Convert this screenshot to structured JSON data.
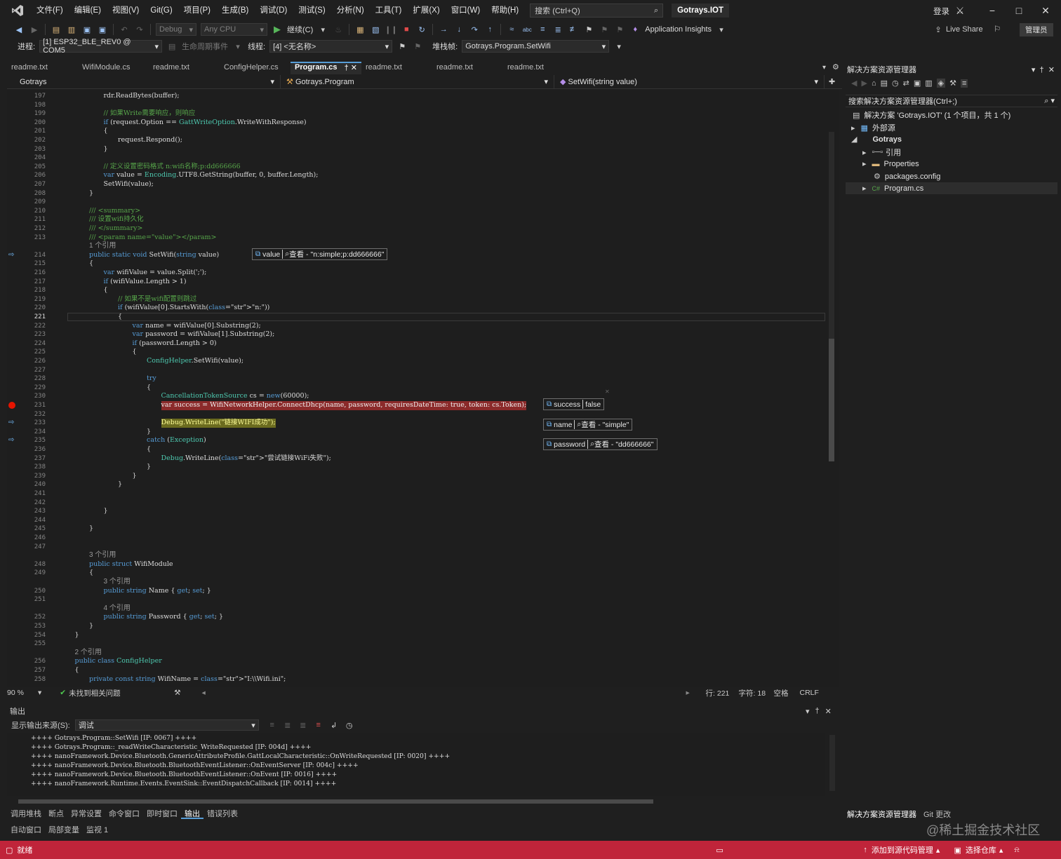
{
  "titlebar": {
    "menus": [
      "文件(F)",
      "编辑(E)",
      "视图(V)",
      "Git(G)",
      "项目(P)",
      "生成(B)",
      "调试(D)",
      "测试(S)",
      "分析(N)",
      "工具(T)",
      "扩展(X)",
      "窗口(W)",
      "帮助(H)"
    ],
    "search_placeholder": "搜索 (Ctrl+Q)",
    "app_title": "Gotrays.IOT",
    "login": "登录"
  },
  "toolbar1": {
    "config": "Debug",
    "platform": "Any CPU",
    "continue": "继续(C)",
    "app_insights": "Application Insights",
    "live_share": "Live Share",
    "admin": "管理员"
  },
  "toolbar2": {
    "process_label": "进程:",
    "process_value": "[1] ESP32_BLE_REV0 @ COM5",
    "lifecycle": "生命周期事件",
    "thread_label": "线程:",
    "thread_value": "[4] <无名称>",
    "stackframe_label": "堆栈帧:",
    "stackframe_value": "Gotrays.Program.SetWifi"
  },
  "tabs": [
    "readme.txt",
    "WifiModule.cs",
    "readme.txt",
    "ConfigHelper.cs",
    "Program.cs",
    "readme.txt",
    "readme.txt",
    "readme.txt"
  ],
  "navbar": {
    "project": "Gotrays",
    "type": "Gotrays.Program",
    "member": "SetWifi(string value)"
  },
  "code_lines": [
    {
      "n": "197",
      "t": "rdr.ReadBytes(buffer);",
      "ind": 3,
      "c": "nm"
    },
    {
      "n": "198",
      "t": "",
      "ind": 0,
      "c": "nm"
    },
    {
      "n": "199",
      "t": "// 如果Write需要响应，则响应",
      "ind": 3,
      "c": "cmt"
    },
    {
      "n": "200",
      "t": "if (request.Option == GattWriteOption.WriteWithResponse)",
      "ind": 3,
      "c": "nm"
    },
    {
      "n": "201",
      "t": "{",
      "ind": 3,
      "c": "nm"
    },
    {
      "n": "202",
      "t": "request.Respond();",
      "ind": 4,
      "c": "nm"
    },
    {
      "n": "203",
      "t": "}",
      "ind": 3,
      "c": "nm"
    },
    {
      "n": "204",
      "t": "",
      "ind": 0,
      "c": "nm"
    },
    {
      "n": "205",
      "t": "// 定义设置密码格式 n:wifi名称;p:dd666666",
      "ind": 3,
      "c": "cmt"
    },
    {
      "n": "206",
      "t": "var value = Encoding.UTF8.GetString(buffer, 0, buffer.Length);",
      "ind": 3,
      "c": "nm"
    },
    {
      "n": "207",
      "t": "SetWifi(value);",
      "ind": 3,
      "c": "nm"
    },
    {
      "n": "208",
      "t": "}",
      "ind": 2,
      "c": "nm"
    },
    {
      "n": "209",
      "t": "",
      "ind": 0,
      "c": "nm"
    },
    {
      "n": "210",
      "t": "/// <summary>",
      "ind": 2,
      "c": "cmt"
    },
    {
      "n": "211",
      "t": "/// 设置wifi持久化",
      "ind": 2,
      "c": "cmt"
    },
    {
      "n": "212",
      "t": "/// </summary>",
      "ind": 2,
      "c": "cmt"
    },
    {
      "n": "213",
      "t": "/// <param name=\"value\"></param>",
      "ind": 2,
      "c": "cmt"
    },
    {
      "n": "",
      "t": "1 个引用",
      "ind": 2,
      "c": "lens"
    },
    {
      "n": "214",
      "t": "public static void SetWifi(string value)",
      "ind": 2,
      "c": "kw"
    },
    {
      "n": "215",
      "t": "{",
      "ind": 2,
      "c": "nm"
    },
    {
      "n": "216",
      "t": "var wifiValue = value.Split(';');",
      "ind": 3,
      "c": "nm"
    },
    {
      "n": "217",
      "t": "if (wifiValue.Length > 1)",
      "ind": 3,
      "c": "nm"
    },
    {
      "n": "218",
      "t": "{",
      "ind": 3,
      "c": "nm"
    },
    {
      "n": "219",
      "t": "// 如果不是wifi配置则跳过",
      "ind": 4,
      "c": "cmt"
    },
    {
      "n": "220",
      "t": "if (wifiValue[0].StartsWith(\"n:\"))",
      "ind": 4,
      "c": "nm"
    },
    {
      "n": "221",
      "t": "{",
      "ind": 4,
      "c": "nm"
    },
    {
      "n": "222",
      "t": "var name = wifiValue[0].Substring(2);",
      "ind": 5,
      "c": "nm"
    },
    {
      "n": "223",
      "t": "var password = wifiValue[1].Substring(2);",
      "ind": 5,
      "c": "nm"
    },
    {
      "n": "224",
      "t": "if (password.Length > 0)",
      "ind": 5,
      "c": "nm"
    },
    {
      "n": "225",
      "t": "{",
      "ind": 5,
      "c": "nm"
    },
    {
      "n": "226",
      "t": "ConfigHelper.SetWifi(value);",
      "ind": 6,
      "c": "nm"
    },
    {
      "n": "227",
      "t": "",
      "ind": 0,
      "c": "nm"
    },
    {
      "n": "228",
      "t": "try",
      "ind": 6,
      "c": "kw"
    },
    {
      "n": "229",
      "t": "{",
      "ind": 6,
      "c": "nm"
    },
    {
      "n": "230",
      "t": "CancellationTokenSource cs = new(60000);",
      "ind": 7,
      "c": "cls"
    },
    {
      "n": "231",
      "t": "var success = WifiNetworkHelper.ConnectDhcp(name, password, requiresDateTime: true, token: cs.Token);",
      "ind": 7,
      "c": "bp"
    },
    {
      "n": "232",
      "t": "",
      "ind": 0,
      "c": "nm"
    },
    {
      "n": "233",
      "t": "Debug.WriteLine(\"链接WIFI成功\");",
      "ind": 7,
      "c": "cur"
    },
    {
      "n": "234",
      "t": "}",
      "ind": 6,
      "c": "nm"
    },
    {
      "n": "235",
      "t": "catch (Exception)",
      "ind": 6,
      "c": "kw"
    },
    {
      "n": "236",
      "t": "{",
      "ind": 6,
      "c": "nm"
    },
    {
      "n": "237",
      "t": "Debug.WriteLine(\"尝试链接WiFi失败\");",
      "ind": 7,
      "c": "cls"
    },
    {
      "n": "238",
      "t": "}",
      "ind": 6,
      "c": "nm"
    },
    {
      "n": "239",
      "t": "}",
      "ind": 5,
      "c": "nm"
    },
    {
      "n": "240",
      "t": "}",
      "ind": 4,
      "c": "nm"
    },
    {
      "n": "241",
      "t": "",
      "ind": 0,
      "c": "nm"
    },
    {
      "n": "242",
      "t": "",
      "ind": 0,
      "c": "nm"
    },
    {
      "n": "243",
      "t": "}",
      "ind": 3,
      "c": "nm"
    },
    {
      "n": "244",
      "t": "",
      "ind": 0,
      "c": "nm"
    },
    {
      "n": "245",
      "t": "}",
      "ind": 2,
      "c": "nm"
    },
    {
      "n": "246",
      "t": "",
      "ind": 0,
      "c": "nm"
    },
    {
      "n": "247",
      "t": "",
      "ind": 0,
      "c": "nm"
    },
    {
      "n": "",
      "t": "3 个引用",
      "ind": 2,
      "c": "lens"
    },
    {
      "n": "248",
      "t": "public struct WifiModule",
      "ind": 2,
      "c": "kw"
    },
    {
      "n": "249",
      "t": "{",
      "ind": 2,
      "c": "nm"
    },
    {
      "n": "",
      "t": "3 个引用",
      "ind": 3,
      "c": "lens"
    },
    {
      "n": "250",
      "t": "public string Name { get; set; }",
      "ind": 3,
      "c": "kw"
    },
    {
      "n": "251",
      "t": "",
      "ind": 0,
      "c": "nm"
    },
    {
      "n": "",
      "t": "4 个引用",
      "ind": 3,
      "c": "lens"
    },
    {
      "n": "252",
      "t": "public string Password { get; set; }",
      "ind": 3,
      "c": "kw"
    },
    {
      "n": "253",
      "t": "}",
      "ind": 2,
      "c": "nm"
    },
    {
      "n": "254",
      "t": "}",
      "ind": 1,
      "c": "nm"
    },
    {
      "n": "255",
      "t": "",
      "ind": 0,
      "c": "nm"
    },
    {
      "n": "",
      "t": "2 个引用",
      "ind": 1,
      "c": "lens"
    },
    {
      "n": "256",
      "t": "public class ConfigHelper",
      "ind": 1,
      "c": "kw"
    },
    {
      "n": "257",
      "t": "{",
      "ind": 1,
      "c": "nm"
    },
    {
      "n": "258",
      "t": "private const string WifiName = \"I:\\\\Wifi.ini\";",
      "ind": 2,
      "c": "kw"
    }
  ],
  "datatips": {
    "value": {
      "name": "value",
      "text": "查看 - \"n:simple;p:dd666666\""
    },
    "success": {
      "name": "success",
      "text": "false"
    },
    "name": {
      "name": "name",
      "text": "查看 - \"simple\""
    },
    "password": {
      "name": "password",
      "text": "查看 - \"dd666666\""
    }
  },
  "editor_status": {
    "zoom": "90 %",
    "issues": "未找到相关问题",
    "line": "行: 221",
    "col": "字符: 18",
    "spaces": "空格",
    "eol": "CRLF"
  },
  "output": {
    "title": "输出",
    "source_label": "显示输出来源(S):",
    "source_value": "调试",
    "lines": [
      "++++ Gotrays.Program::SetWifi [IP: 0067] ++++",
      "++++ Gotrays.Program::_readWriteCharacteristic_WriteRequested [IP: 004d] ++++",
      "++++ nanoFramework.Device.Bluetooth.GenericAttributeProfile.GattLocalCharacteristic::OnWriteRequested [IP: 0020] ++++",
      "++++ nanoFramework.Device.Bluetooth.BluetoothEventListener::OnEventServer [IP: 004c] ++++",
      "++++ nanoFramework.Device.Bluetooth.BluetoothEventListener::OnEvent [IP: 0016] ++++",
      "++++ nanoFramework.Runtime.Events.EventSink::EventDispatchCallback [IP: 0014] ++++"
    ]
  },
  "bottom_tabs": [
    "调用堆栈",
    "断点",
    "异常设置",
    "命令窗口",
    "即时窗口",
    "输出",
    "错误列表"
  ],
  "bottom_tabs2": [
    "自动窗口",
    "局部变量",
    "监视 1"
  ],
  "solution_explorer": {
    "title": "解决方案资源管理器",
    "search": "搜索解决方案资源管理器(Ctrl+;)",
    "solution": "解决方案 'Gotrays.IOT' (1 个项目，共 1 个)",
    "external": "外部源",
    "project": "Gotrays",
    "refs": "引用",
    "properties": "Properties",
    "packages": "packages.config",
    "program": "Program.cs",
    "tabs": [
      "解决方案资源管理器",
      "Git 更改"
    ]
  },
  "statusbar": {
    "ready": "就绪",
    "add_source": "添加到源代码管理",
    "select_repo": "选择仓库"
  },
  "watermark": "@稀土掘金技术社区"
}
